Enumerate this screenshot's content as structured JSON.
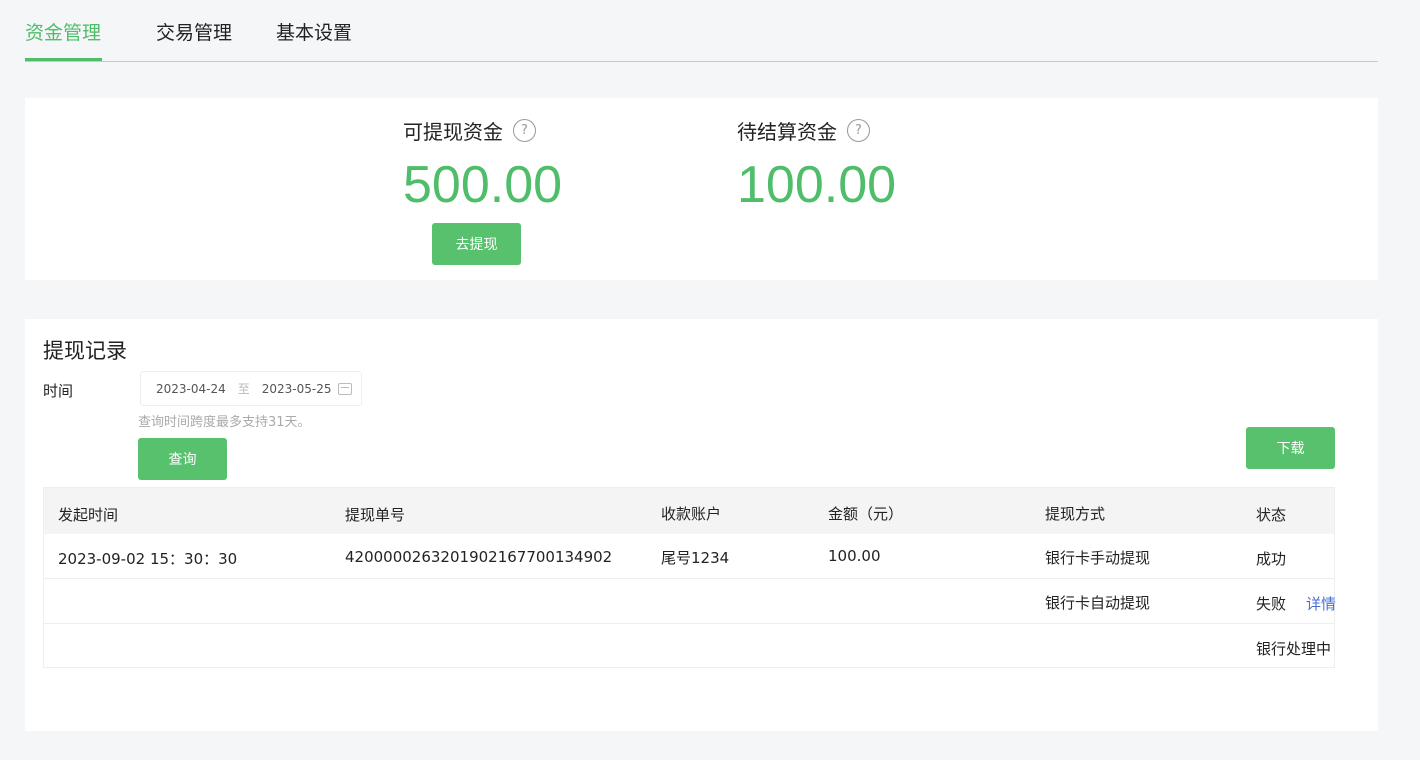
{
  "tabs": [
    {
      "label": "资金管理",
      "active": true
    },
    {
      "label": "交易管理",
      "active": false
    },
    {
      "label": "基本设置",
      "active": false
    }
  ],
  "summary": {
    "withdrawable": {
      "label": "可提现资金",
      "amount": "500.00",
      "help_icon": "question-circle-icon"
    },
    "pending": {
      "label": "待结算资金",
      "amount": "100.00",
      "help_icon": "question-circle-icon"
    },
    "withdraw_button": "去提现"
  },
  "records": {
    "title": "提现记录",
    "filter": {
      "time_label": "时间",
      "start_date": "2023-04-24",
      "separator": "至",
      "end_date": "2023-05-25",
      "calendar_icon": "calendar-icon",
      "hint": "查询时间跨度最多支持31天。"
    },
    "query_button": "查询",
    "download_button": "下载",
    "table": {
      "columns": [
        "发起时间",
        "提现单号",
        "收款账户",
        "金额（元）",
        "提现方式",
        "状态"
      ],
      "rows": [
        {
          "time": "2023-09-02  15：30：30",
          "order_no": "4200000263201902167700134902",
          "account": "尾号1234",
          "amount": "100.00",
          "method": "银行卡手动提现",
          "status": "成功",
          "action": ""
        },
        {
          "time": "",
          "order_no": "",
          "account": "",
          "amount": "",
          "method": "银行卡自动提现",
          "status": "失败",
          "action": "详情"
        },
        {
          "time": "",
          "order_no": "",
          "account": "",
          "amount": "",
          "method": "",
          "status": "银行处理中",
          "action": ""
        }
      ]
    }
  },
  "colors": {
    "accent": "#4fbd6a",
    "button": "#57c16d",
    "link": "#4a6fd4"
  }
}
